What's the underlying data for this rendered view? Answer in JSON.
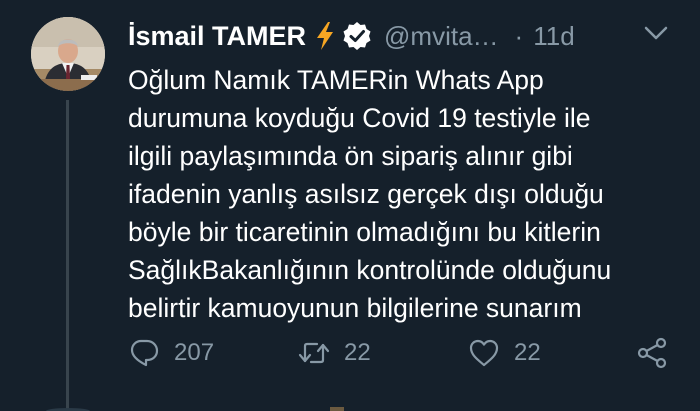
{
  "tweet": {
    "author_name": "İsmail TAMER",
    "handle": "@mvita…",
    "separator": "·",
    "time": "11d",
    "lines": [
      "Oğlum Namık TAMERin Whats App",
      "durumuna koyduğu Covid 19 testiyle ile",
      "ilgili paylaşımında ön sipariş alınır gibi",
      "ifadenin yanlış asılsız gerçek dışı olduğu",
      "böyle bir ticaretinin olmadığını bu kitlerin",
      "SağlıkBakanlığının  kontrolünde olduğunu",
      "belirtir kamuoyunun bilgilerine sunarım"
    ]
  },
  "actions": {
    "replies": "207",
    "retweets": "22",
    "likes": "22"
  },
  "icons": {
    "bolt": "lightning-bolt-icon",
    "verified": "verified-badge-icon",
    "more": "chevron-down-icon",
    "reply": "reply-icon",
    "retweet": "retweet-icon",
    "like": "heart-icon",
    "share": "share-icon"
  },
  "colors": {
    "background": "#15202b",
    "text": "#ffffff",
    "muted": "#8899a6",
    "bolt": "#f6a623",
    "thread_line": "#38444d"
  }
}
